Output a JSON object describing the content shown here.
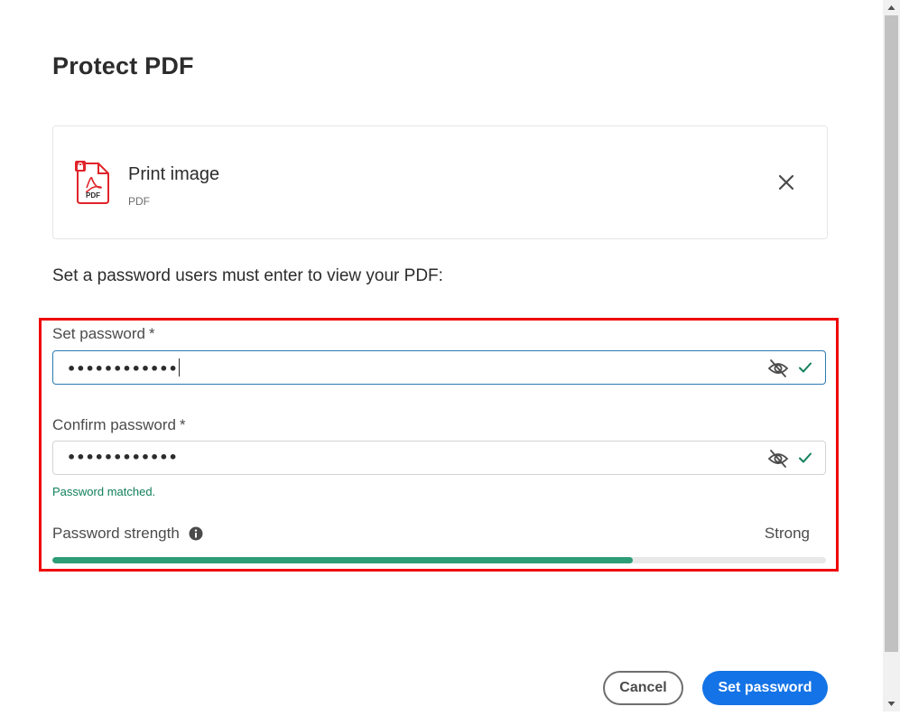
{
  "dialog": {
    "title": "Protect PDF"
  },
  "file": {
    "name": "Print image",
    "type": "PDF",
    "icon_label": "PDF",
    "icon": "pdf-lock-icon",
    "close_icon": "close-icon"
  },
  "instruction": "Set a password users must enter to view your PDF:",
  "set_password": {
    "label": "Set password",
    "required_mark": "*",
    "value": "••••••••••••",
    "visibility_icon": "eye-off-icon",
    "valid_icon": "checkmark-icon"
  },
  "confirm_password": {
    "label": "Confirm password",
    "required_mark": "*",
    "value": "••••••••••••",
    "visibility_icon": "eye-off-icon",
    "valid_icon": "checkmark-icon",
    "status": "Password matched."
  },
  "strength": {
    "label": "Password strength",
    "info_icon": "info-icon",
    "value": "Strong",
    "level_percent": 75
  },
  "buttons": {
    "cancel": "Cancel",
    "submit": "Set password"
  },
  "colors": {
    "accent": "#1473e6",
    "success": "#12805c",
    "meter": "#2d9d78",
    "pdf_red": "#e0242a",
    "highlight": "#ee0000"
  }
}
